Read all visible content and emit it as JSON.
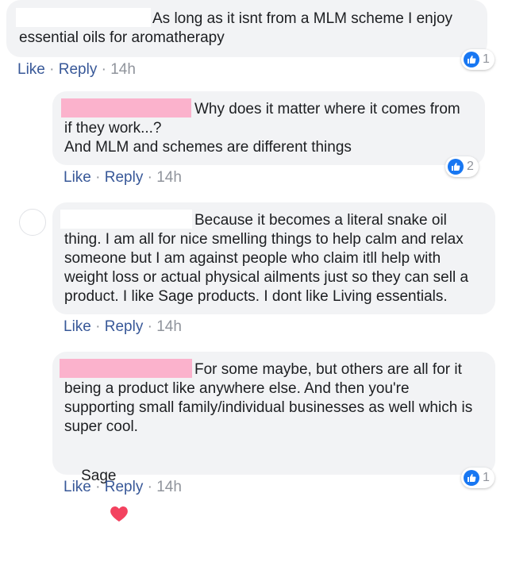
{
  "comments": [
    {
      "text": "As long as it isnt from a MLM scheme I enjoy\nessential oils for aromatherapy",
      "like": "Like",
      "reply": "Reply",
      "time": "14h",
      "reactions": "1"
    },
    {
      "text": "Why does it matter where it comes from\nif they work...?\nAnd MLM and schemes are different things",
      "like": "Like",
      "reply": "Reply",
      "time": "14h",
      "reactions": "2"
    },
    {
      "text": "Because it becomes a literal snake oil\nthing. I am all for nice smelling things to help calm and relax\nsomeone but I am against people who claim itll help with\nweight loss or actual physical ailments just so they can sell a\nproduct. I like Sage products. I dont like Living essentials.",
      "like": "Like",
      "reply": "Reply",
      "time": "14h"
    },
    {
      "text": "For some maybe, but others are all for it\nbeing a product like anywhere else. And then you're\nsupporting small family/individual businesses as well which is\nsuper cool.",
      "signature": "Sage",
      "like": "Like",
      "reply": "Reply",
      "time": "14h",
      "reactions": "1"
    }
  ],
  "separator": "·",
  "colors": {
    "bubble": "#f2f3f5",
    "link": "#385898",
    "meta": "#90949c",
    "like_blue": "#1877f2",
    "heart": "#f3425f",
    "redaction_pink": "#fbb2cc"
  }
}
